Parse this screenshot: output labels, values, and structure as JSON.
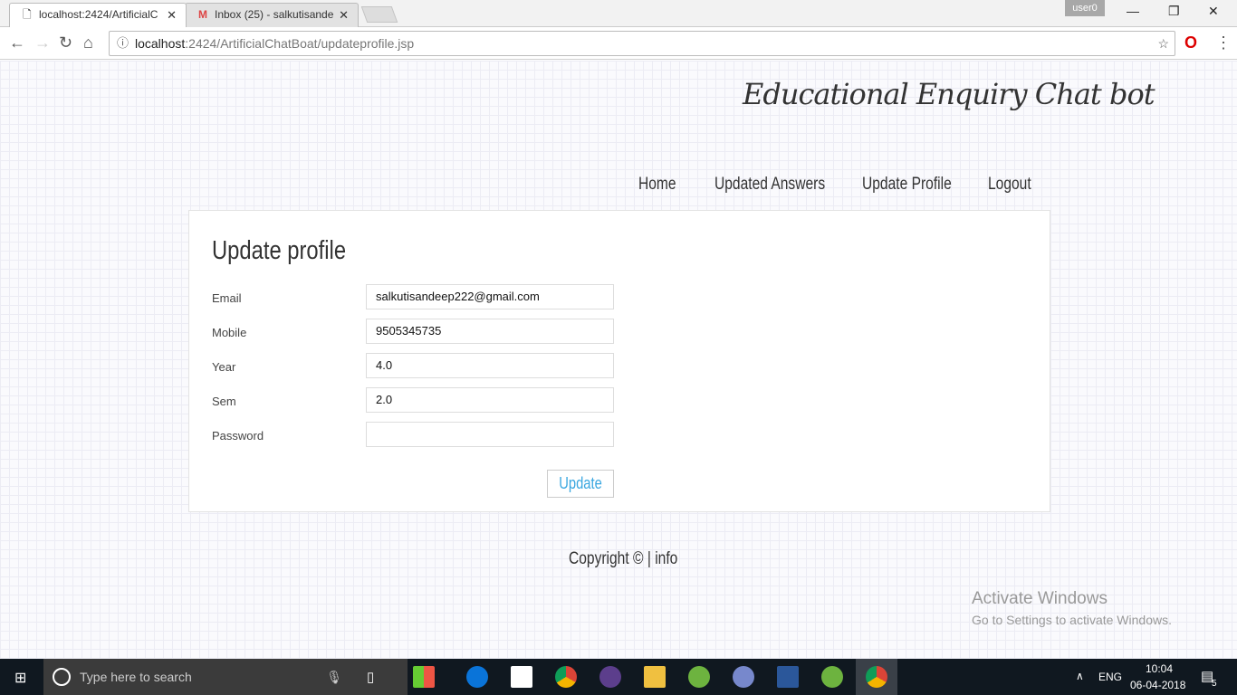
{
  "browser": {
    "tabs": [
      {
        "label": "localhost:2424/ArtificialC"
      },
      {
        "label": "Inbox (25) - salkutisande"
      }
    ],
    "user": "user0",
    "url_host": "localhost",
    "url_rest": ":2424/ArtificialChatBoat/updateprofile.jsp"
  },
  "site": {
    "logo": "Educational Enquiry Chat bot",
    "nav": [
      "Home",
      "Updated Answers",
      "Update Profile",
      "Logout"
    ]
  },
  "form": {
    "title": "Update profile",
    "fields": [
      {
        "label": "Email",
        "value": "salkutisandeep222@gmail.com"
      },
      {
        "label": "Mobile",
        "value": "9505345735"
      },
      {
        "label": "Year",
        "value": "4.0"
      },
      {
        "label": "Sem",
        "value": "2.0"
      },
      {
        "label": "Password",
        "value": ""
      }
    ],
    "submit": "Update"
  },
  "footer": {
    "text": "Copyright © | info"
  },
  "watermark": {
    "title": "Activate Windows",
    "subtitle": "Go to Settings to activate Windows."
  },
  "taskbar": {
    "search_placeholder": "Type here to search",
    "lang": "ENG",
    "time": "10:04",
    "date": "06-04-2018",
    "notifications": "5"
  }
}
